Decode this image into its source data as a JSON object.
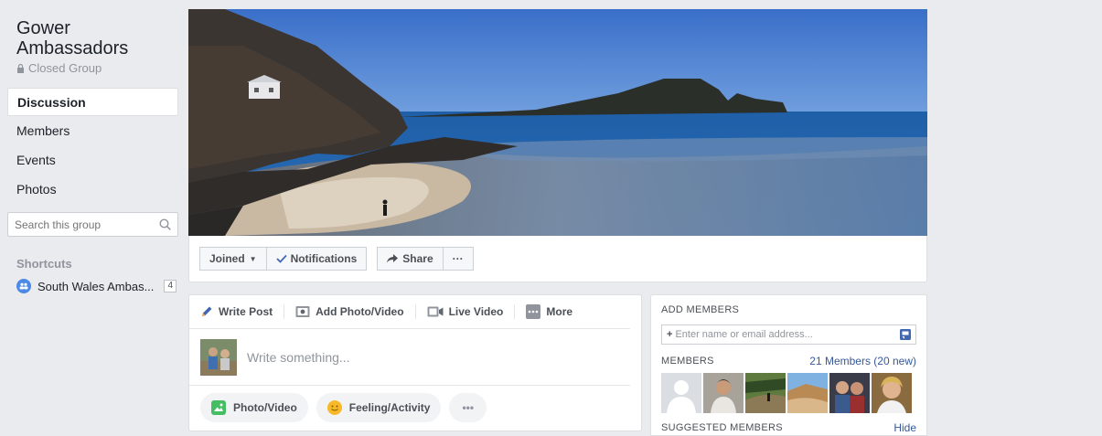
{
  "group": {
    "name": "Gower Ambassadors",
    "privacy": "Closed Group"
  },
  "nav": [
    {
      "label": "Discussion",
      "active": true
    },
    {
      "label": "Members"
    },
    {
      "label": "Events"
    },
    {
      "label": "Photos"
    }
  ],
  "search": {
    "placeholder": "Search this group"
  },
  "shortcuts": {
    "title": "Shortcuts",
    "items": [
      {
        "label": "South Wales Ambas...",
        "count": "4"
      }
    ]
  },
  "actions": {
    "joined": "Joined",
    "notifications": "Notifications",
    "share": "Share",
    "more": "···"
  },
  "composer": {
    "tabs": [
      "Write Post",
      "Add Photo/Video",
      "Live Video",
      "More"
    ],
    "placeholder": "Write something...",
    "buttons": [
      "Photo/Video",
      "Feeling/Activity",
      "•••"
    ]
  },
  "right_panel": {
    "add_members_title": "ADD MEMBERS",
    "add_members_placeholder": "Enter name or email address...",
    "members_title": "MEMBERS",
    "members_count": "21 Members (20 new)",
    "suggested_title": "SUGGESTED MEMBERS",
    "hide": "Hide"
  },
  "colors": {
    "background": "#e9ebee",
    "link": "#365899",
    "accent": "#4267b2"
  }
}
